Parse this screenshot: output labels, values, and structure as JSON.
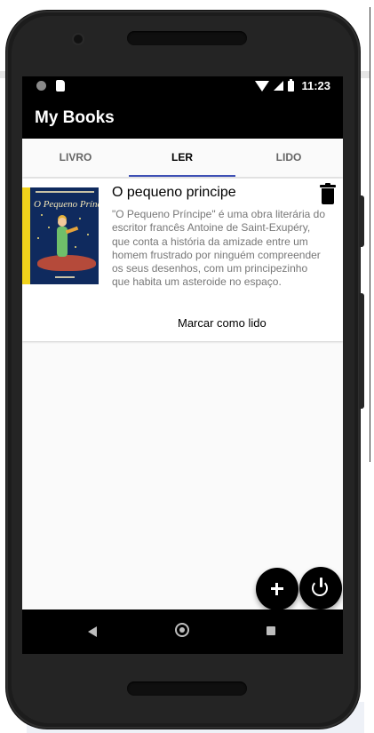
{
  "status_bar": {
    "time": "11:23"
  },
  "app_bar": {
    "title": "My Books"
  },
  "tabs": [
    {
      "label": "LIVRO",
      "selected": false
    },
    {
      "label": "LER",
      "selected": true
    },
    {
      "label": "LIDO",
      "selected": false
    }
  ],
  "book": {
    "title": "O pequeno principe",
    "description": "\"O Pequeno Príncipe\" é uma obra literária do escritor francês Antoine de Saint-Exupéry, que conta a história da amizade entre um homem frustrado por ninguém compreender os seus desenhos, com um principezinho que habita um asteroide no espaço.",
    "cover_title": "O Pequeno Príncipe",
    "action_label": "Marcar como lido"
  },
  "fabs": {
    "add_icon": "plus-icon",
    "power_icon": "power-icon"
  },
  "colors": {
    "tab_indicator": "#3f51b5",
    "app_bar": "#000000",
    "cover_bg": "#0f2a5e",
    "cover_spine": "#f1d21b"
  }
}
